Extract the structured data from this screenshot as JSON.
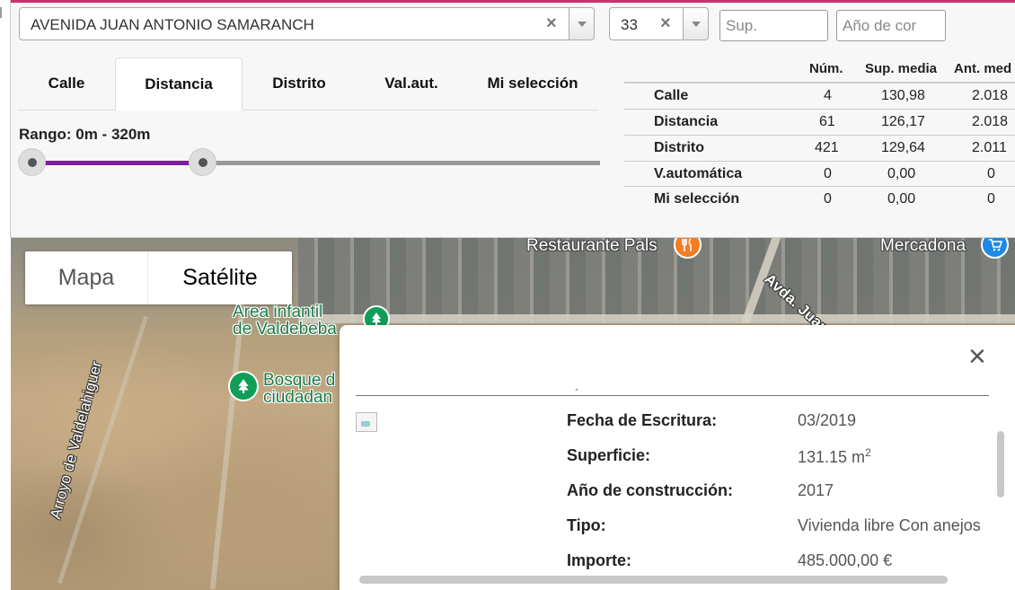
{
  "filters": {
    "street_value": "AVENIDA JUAN ANTONIO SAMARANCH",
    "number_value": "33",
    "surface_placeholder": "Sup.",
    "year_placeholder": "Año de cor",
    "clear_glyph": "×"
  },
  "tabs": [
    {
      "label": "Calle",
      "active": false
    },
    {
      "label": "Distancia",
      "active": true
    },
    {
      "label": "Distrito",
      "active": false
    },
    {
      "label": "Val.aut.",
      "active": false
    },
    {
      "label": "Mi selección",
      "active": false
    }
  ],
  "range": {
    "label": "Rango: 0m - 320m",
    "min_value": 0,
    "max_value": 320,
    "fill_fraction": 0.3,
    "fill_color": "#7b1fa2"
  },
  "stats": {
    "headers": [
      "Núm.",
      "Sup. media",
      "Ant. med"
    ],
    "rows": [
      {
        "label": "Calle",
        "num": "4",
        "sup": "130,98",
        "ant": "2.018"
      },
      {
        "label": "Distancia",
        "num": "61",
        "sup": "126,17",
        "ant": "2.018"
      },
      {
        "label": "Distrito",
        "num": "421",
        "sup": "129,64",
        "ant": "2.011"
      },
      {
        "label": "V.automática",
        "num": "0",
        "sup": "0,00",
        "ant": "0"
      },
      {
        "label": "Mi selección",
        "num": "0",
        "sup": "0,00",
        "ant": "0"
      }
    ]
  },
  "map": {
    "type_options": [
      "Mapa",
      "Satélite"
    ],
    "selected_type": "Satélite",
    "labels": {
      "restaurant": "Restaurante Pals",
      "supermarket": "Mercadona",
      "street": "Avda. Juan Antonio Samaranch",
      "park_line1": "Area infantil",
      "park_line2": "de Valdebeba",
      "forest_line1": "Bosque d",
      "forest_line2": "ciudadan",
      "stream": "Arroyo de Valdelahiguer"
    },
    "icons": {
      "restaurant": "fork-knife-icon",
      "supermarket": "cart-icon",
      "park": "tree-icon",
      "forest": "tree-icon"
    },
    "colors": {
      "restaurant_pin": "#f57c1f",
      "supermarket_pin": "#1e88e5",
      "park_pin": "#0f9d58"
    }
  },
  "popup": {
    "close_glyph": "×",
    "top_mark": "´",
    "details": [
      {
        "label": "Fecha de Escritura:",
        "value": "03/2019"
      },
      {
        "label": "Superficie:",
        "value": "131.15 m",
        "sup": "2"
      },
      {
        "label": "Año de construcción:",
        "value": "2017"
      },
      {
        "label": "Tipo:",
        "value": "Vivienda libre Con anejos"
      },
      {
        "label": "Importe:",
        "value": "485.000,00 €"
      }
    ]
  }
}
